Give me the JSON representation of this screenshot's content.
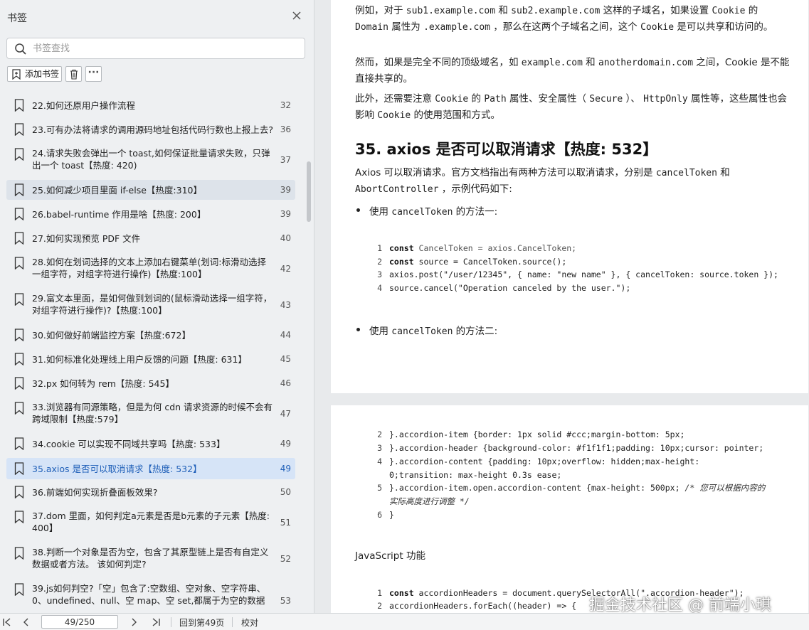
{
  "sidebar": {
    "title": "书签",
    "search_placeholder": "书签查找",
    "add_label": "添加书签",
    "more_label": "···",
    "items": [
      {
        "title": "22.如何还原用户操作流程",
        "page": "32"
      },
      {
        "title": "23.可有办法将请求的调用源码地址包括代码行数也上报上去?",
        "page": "36"
      },
      {
        "title": "24.请求失败会弹出一个 toast,如何保证批量请求失败，只弹出一个 toast【热度: 420)",
        "page": "37"
      },
      {
        "title": "25.如何减少项目里面 if-else【热度:310】",
        "page": "39"
      },
      {
        "title": "26.babel-runtime 作用是啥【热度: 200】",
        "page": "39"
      },
      {
        "title": "27.如何实现预览 PDF 文件",
        "page": "40"
      },
      {
        "title": "28.如何在划词选择的文本上添加右键菜单(划词:标滑动选择一组字符，对组字符进行操作)【热度:100】",
        "page": "42"
      },
      {
        "title": "29.富文本里面，是如何做到划词的(鼠标滑动选择一组字符，对组字符进行操作)?【热度:100】",
        "page": "43"
      },
      {
        "title": "30.如何做好前端监控方案【热度:672】",
        "page": "44"
      },
      {
        "title": "31.如何标准化处理线上用户反馈的问题【热度: 631】",
        "page": "45"
      },
      {
        "title": "32.px 如何转为 rem【热度: 545】",
        "page": "46"
      },
      {
        "title": "33.浏览器有同源策略，但是为何 cdn 请求资源的时候不会有跨域限制【热度:579】",
        "page": "47"
      },
      {
        "title": "34.cookie 可以实现不同域共享吗【热度: 533】",
        "page": "49"
      },
      {
        "title": "35.axios 是否可以取消请求【热度: 532】",
        "page": "49"
      },
      {
        "title": "36.前端如何实现折叠面板效果?",
        "page": "50"
      },
      {
        "title": "37.dom 里面，如何判定a元素是否是b元素的子元素【热度: 400】",
        "page": "51"
      },
      {
        "title": "38.判断一个对象是否为空，包含了其原型链上是否有自定义数据或者方法。 该如何判定?",
        "page": "52"
      },
      {
        "title": "39.js如何判空?「空」包含了:空数组、空对象、空字符串、0、undefined、null、空 map、空 set,都属于为空的数据【热度:640",
        "page": "53"
      }
    ]
  },
  "status": {
    "page_value": "49/250",
    "back_label": "回到第49页",
    "proof_label": "校对"
  },
  "page1": {
    "p1": {
      "a": "例如，对于 ",
      "b": "sub1.example.com",
      "c": " 和 ",
      "d": "sub2.example.com",
      "e": " 这样的子域名，如果设置 ",
      "f": "Cookie",
      "g": " 的 ",
      "h": "Domain",
      "i": " 属性为 ",
      "j": ".example.com",
      "k": " ，那么在这两个子域名之间，这个 ",
      "l": "Cookie",
      "m": " 是可以共享和访问的。"
    },
    "p2": {
      "a": "然而，如果是完全不同的顶级域名，如 ",
      "b": "example.com",
      "c": " 和 ",
      "d": "anotherdomain.com",
      "e": " 之间，Cookie 是不能直接共享的。"
    },
    "p3": {
      "a": "此外，还需要注意 ",
      "b": "Cookie",
      "c": " 的 ",
      "d": "Path",
      "e": " 属性、安全属性（ ",
      "f": "Secure",
      "g": " ）、 ",
      "h": "HttpOnly",
      "i": " 属性等，这些属性也会影响 ",
      "j": "Cookie",
      "k": " 的使用范围和方式。"
    },
    "heading": "35. axios 是否可以取消请求【热度: 532】",
    "p4": {
      "a": "Axios 可以取消请求。官方文档指出有两种方法可以取消请求，分别是 ",
      "b": "cancelToken",
      "c": " 和 ",
      "d": "AbortController",
      "e": " ，示例代码如下:"
    },
    "bullet1": {
      "a": "使用 ",
      "b": "cancelToken",
      "c": " 的方法一:"
    },
    "code1": {
      "l1": {
        "n": "1",
        "kw": "const",
        "rest": " CancelToken = axios.CancelToken;"
      },
      "l2": {
        "n": "2",
        "kw": "const",
        "rest": " source = CancelToken.source();"
      },
      "l3": {
        "n": "3",
        "code": "axios.post(\"/user/12345\", { name: \"new name\" }, { cancelToken: source.token });"
      },
      "l4": {
        "n": "4",
        "code": "source.cancel(\"Operation canceled by the user.\");"
      }
    },
    "bullet2": {
      "a": "使用  ",
      "b": "cancelToken",
      "c": " 的方法二:"
    }
  },
  "page2": {
    "code": {
      "l2": {
        "n": "2",
        "code": "}.accordion-item {border: 1px solid #ccc;margin-bottom: 5px;"
      },
      "l3": {
        "n": "3",
        "code": "}.accordion-header {background-color: #f1f1f1;padding: 10px;cursor: pointer;"
      },
      "l4": {
        "n": "4",
        "code": "}.accordion-content {padding: 10px;overflow: hidden;max-height: 0;transition: max-height 0.3s ease;"
      },
      "l5": {
        "n": "5",
        "code": "}.accordion-item.open.accordion-content {max-height: 500px; ",
        "comment": "/* 您可以根据内容的实际高度进行调整 */"
      },
      "l6": {
        "n": "6",
        "code": "}"
      }
    },
    "js_heading": "JavaScript 功能",
    "code2": {
      "l1": {
        "n": "1",
        "kw": "const",
        "rest": " accordionHeaders = document.querySelectorAll(\".accordion-header\");"
      },
      "l2": {
        "n": "2",
        "code": "accordionHeaders.forEach((header) => {"
      }
    }
  },
  "watermark": "掘金技术社区 @ 前端小琪"
}
